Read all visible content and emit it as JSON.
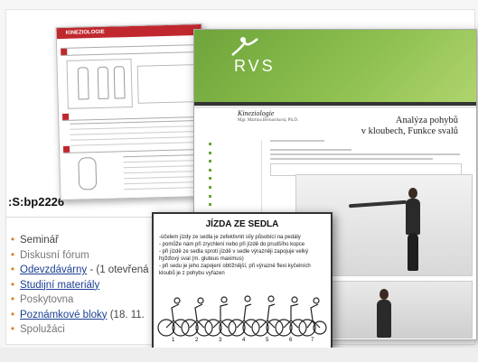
{
  "course": {
    "code": ":S:bp2226",
    "menu": [
      {
        "text": "Seminář",
        "style": "plain"
      },
      {
        "text": "Diskusní fórum",
        "style": "muted"
      },
      {
        "text": "Odevzdávárny",
        "suffix": " - (1 otevřená",
        "style": "link"
      },
      {
        "text": "Studijní materiály",
        "style": "link"
      },
      {
        "text": "Poskytovna",
        "style": "muted"
      },
      {
        "text": "Poznámkové bloky",
        "suffix": " (18. 11.",
        "style": "link"
      },
      {
        "text": "Spolužáci",
        "style": "muted"
      }
    ]
  },
  "doc_kineziologie": {
    "title": "KINEZIOLOGIE"
  },
  "doc_rvs": {
    "logo": "RVS",
    "heading": "Kineziologie",
    "author": "Mgr. Martina Bernaciková, Ph.D.",
    "title_line1": "Analýza pohybů",
    "title_line2": "v kloubech, Funkce svalů"
  },
  "card": {
    "title": "JÍZDA ZE SEDLA",
    "lines": [
      "-účelem jízdy ze sedla je zefektivnit síly působící na pedály",
      "- pomůže nám při zrychlení nebo při jízdě do prudšího kopce",
      "- při jízdě ze sedla sprotí jízdě v sedle výrazněji zapojuje velký hýžďový sval (m. gluteus maximus)",
      "- při sedu je jeho zapojení obtížnější, při výrazné flexi kyčelních kloubů je z pohybu vyřazen"
    ],
    "frame_numbers": [
      "1",
      "2",
      "3",
      "4",
      "5",
      "6",
      "7"
    ]
  }
}
